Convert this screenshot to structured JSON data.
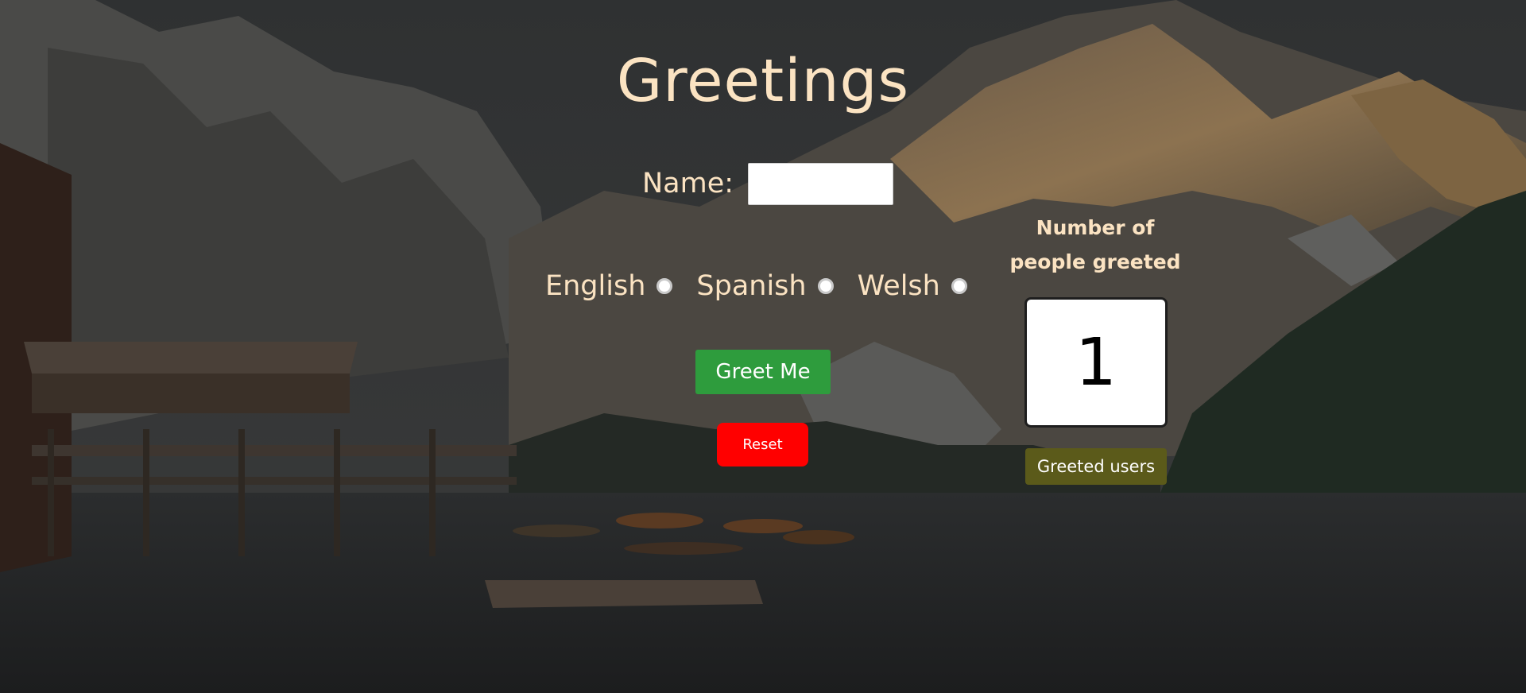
{
  "page": {
    "title": "Greetings"
  },
  "form": {
    "name_label": "Name:",
    "name_value": "",
    "languages": [
      {
        "label": "English",
        "selected": false
      },
      {
        "label": "Spanish",
        "selected": false
      },
      {
        "label": "Welsh",
        "selected": false
      }
    ],
    "greet_button": "Greet Me",
    "reset_button": "Reset"
  },
  "counter": {
    "label": "Number of people greeted",
    "value": "1",
    "users_button": "Greeted users"
  },
  "colors": {
    "title_text": "#fbe3c2",
    "greet_button_bg": "#2e9c3d",
    "reset_button_bg": "#ff0000",
    "users_button_bg": "#5b5a1a"
  }
}
